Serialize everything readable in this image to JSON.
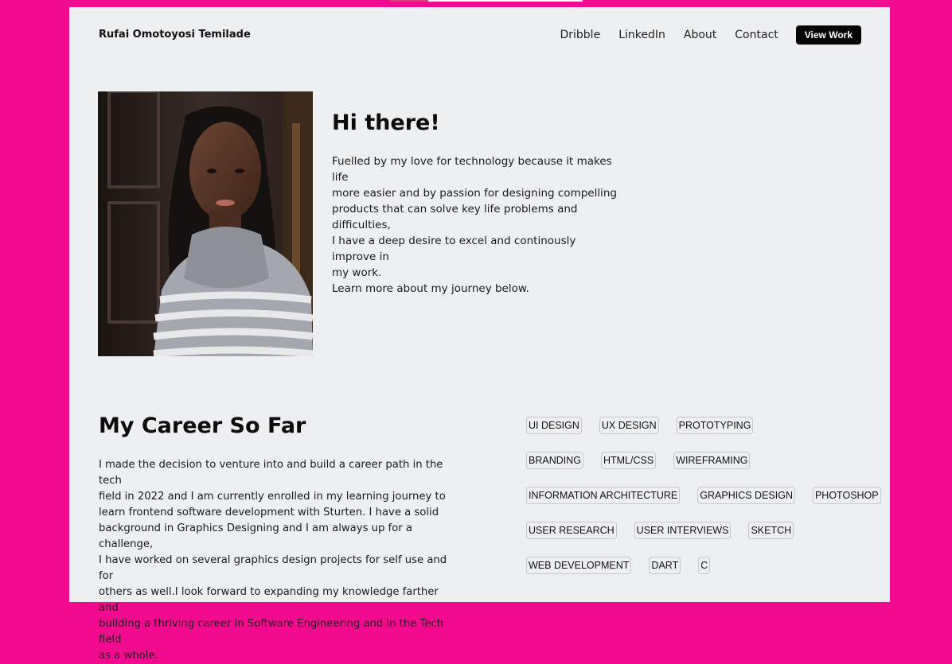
{
  "header": {
    "brand": "Rufai Omotoyosi Temilade",
    "nav": [
      "Dribble",
      "LinkedIn",
      "About",
      "Contact"
    ],
    "cta": "View Work"
  },
  "hero": {
    "title": "Hi there!",
    "lines": [
      "Fuelled by my love for technology because it makes life",
      "more easier and by passion for designing compelling",
      "products that can solve key life problems and difficulties,",
      "I have a deep desire to excel and continously improve in",
      "my work.",
      "Learn more about my journey below."
    ]
  },
  "career": {
    "title": "My Career So Far",
    "lines": [
      "I made the decision to venture into and build a career path in the tech",
      "field in 2022 and I am currently enrolled in my learning journey to",
      "learn frontend software development with Sturten. I have a solid",
      "background in Graphics Designing and I am always up for a challenge,",
      "I have worked on several graphics design projects for self use and for",
      "others as well.I look forward to expanding my knowledge farther and",
      "building a thriving career in Software Engineering and in the Tech field",
      "as a whole."
    ]
  },
  "skills": [
    [
      "UI DESIGN",
      "UX DESIGN",
      "PROTOTYPING"
    ],
    [
      "BRANDING",
      "HTML/CSS",
      "WIREFRAMING"
    ],
    [
      "INFORMATION ARCHITECTURE",
      "GRAPHICS DESIGN",
      "PHOTOSHOP"
    ],
    [
      "USER RESEARCH",
      "USER INTERVIEWS",
      "SKETCH"
    ],
    [
      "WEB DEVELOPMENT",
      "DART",
      "C"
    ]
  ],
  "colors": {
    "background": "#f30b8f",
    "page": "#eeeff1",
    "button": "#050505"
  }
}
